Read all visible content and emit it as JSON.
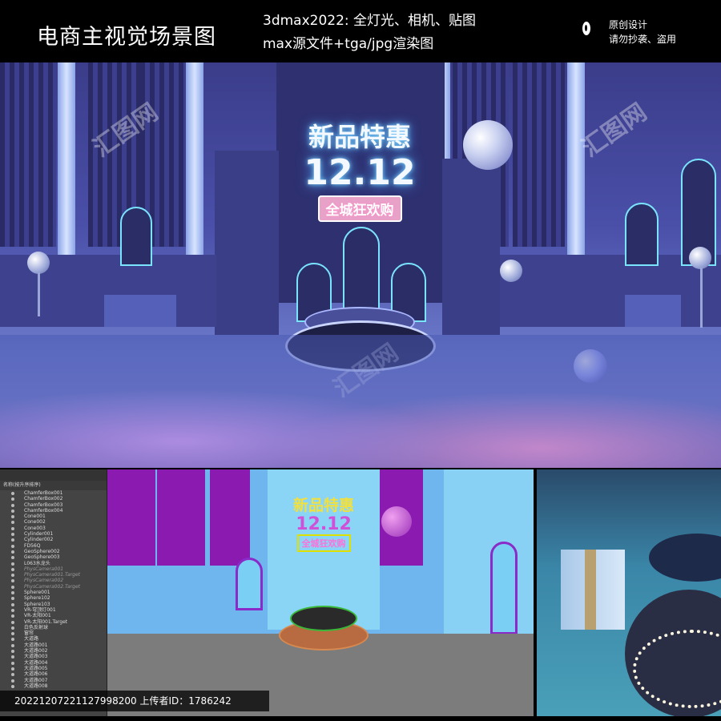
{
  "header": {
    "title": "电商主视觉场景图",
    "info_line1": "3dmax2022: 全灯光、相机、贴图",
    "info_line2": "max源文件+tga/jpg渲染图",
    "note_line1": "原创设计",
    "note_line2": "请勿抄袭、盗用"
  },
  "render": {
    "neon_line1": "新品特惠",
    "neon_line2": "12.12",
    "neon_badge": "全城狂欢购",
    "watermark": "汇图网"
  },
  "scene_explorer": {
    "header": "名称(按升序排序)",
    "objects": [
      {
        "name": "ChamferBox001"
      },
      {
        "name": "ChamferBox002"
      },
      {
        "name": "ChamferBox003"
      },
      {
        "name": "ChamferBox004"
      },
      {
        "name": "Cone001"
      },
      {
        "name": "Cone002"
      },
      {
        "name": "Cone003"
      },
      {
        "name": "Cylinder001"
      },
      {
        "name": "Cylinder002"
      },
      {
        "name": "FD56Q"
      },
      {
        "name": "GeoSphere002"
      },
      {
        "name": "GeoSphere003"
      },
      {
        "name": "L063水龙头"
      },
      {
        "name": "PhysCamera001"
      },
      {
        "name": "PhysCamera001.Target"
      },
      {
        "name": "PhysCamera002"
      },
      {
        "name": "PhysCamera002.Target"
      },
      {
        "name": "Sphere001"
      },
      {
        "name": "Sphere102"
      },
      {
        "name": "Sphere103"
      },
      {
        "name": "VR-穹顶灯001"
      },
      {
        "name": "VR-太阳001"
      },
      {
        "name": "VR-太阳001.Target"
      },
      {
        "name": "白色反射球"
      },
      {
        "name": "窗帘"
      },
      {
        "name": "大道路"
      },
      {
        "name": "大道路001"
      },
      {
        "name": "大道路002"
      },
      {
        "name": "大道路003"
      },
      {
        "name": "大道路004"
      },
      {
        "name": "大道路005"
      },
      {
        "name": "大道路006"
      },
      {
        "name": "大道路007"
      },
      {
        "name": "大道路008"
      }
    ]
  },
  "viewport": {
    "neon_line1": "新品特惠",
    "neon_line2": "12.12",
    "neon_badge": "全城狂欢购"
  },
  "footer": {
    "text": "20221207221127998200 上传者ID：1786242"
  }
}
